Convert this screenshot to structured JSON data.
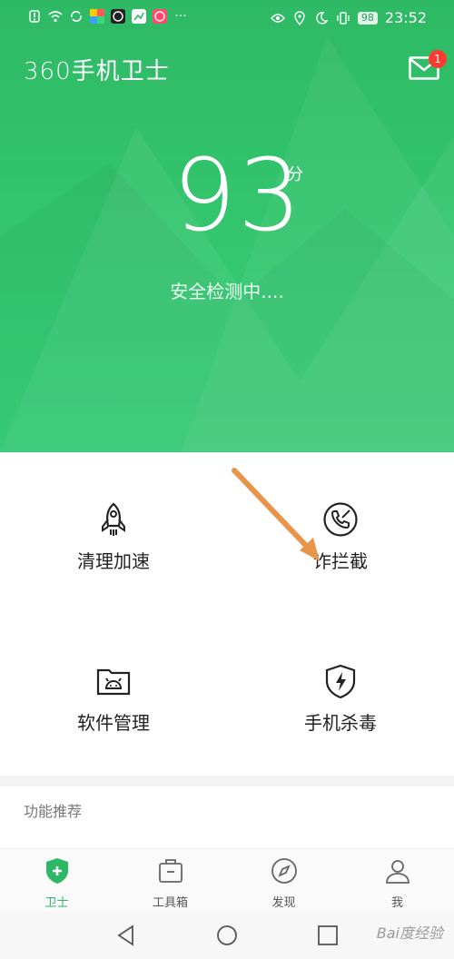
{
  "status_bar": {
    "battery": "98",
    "time": "23:52"
  },
  "header": {
    "app_title": "360手机卫士",
    "mail_badge_count": "1"
  },
  "score": {
    "value": "93",
    "unit": "分",
    "status_text": "安全检测中...."
  },
  "features": [
    {
      "label": "清理加速",
      "icon": "rocket-icon"
    },
    {
      "label": "诈拦截",
      "icon": "phone-block-icon"
    },
    {
      "label": "软件管理",
      "icon": "android-folder-icon"
    },
    {
      "label": "手机杀毒",
      "icon": "shield-bolt-icon"
    }
  ],
  "recommend_title": "功能推荐",
  "tabs": [
    {
      "label": "卫士",
      "icon": "shield-plus-icon",
      "active": true
    },
    {
      "label": "工具箱",
      "icon": "toolbox-icon",
      "active": false
    },
    {
      "label": "发现",
      "icon": "compass-icon",
      "active": false
    },
    {
      "label": "我",
      "icon": "person-icon",
      "active": false
    }
  ],
  "watermark": "Bai度经验",
  "colors": {
    "brand_green": "#2fb965",
    "accent_red": "#ff3b30",
    "arrow_orange": "#e8944a"
  }
}
